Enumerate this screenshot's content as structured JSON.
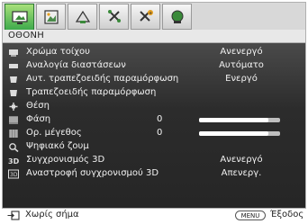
{
  "tabs": [
    {
      "icon": "display-icon",
      "active": true
    },
    {
      "icon": "picture-icon",
      "active": false
    },
    {
      "icon": "source-icon",
      "active": false
    },
    {
      "icon": "settings-icon",
      "active": false
    },
    {
      "icon": "advanced-settings-icon",
      "active": false
    },
    {
      "icon": "information-icon",
      "active": false
    }
  ],
  "section": {
    "title": "ΟΘΟΝΗ"
  },
  "menu": {
    "items": [
      {
        "icon": "wall-color-icon",
        "label": "Χρώμα τοίχου",
        "value": "Ανενεργό"
      },
      {
        "icon": "aspect-ratio-icon",
        "label": "Αναλογία διαστάσεων",
        "value": "Αυτόματο"
      },
      {
        "icon": "auto-keystone-icon",
        "label": "Αυτ. τραπεζοειδής παραμόρφωση",
        "value": "Ενεργό"
      },
      {
        "icon": "keystone-icon",
        "label": "Τραπεζοειδής παραμόρφωση",
        "value": ""
      },
      {
        "icon": "position-icon",
        "label": "Θέση",
        "value": ""
      },
      {
        "icon": "phase-icon",
        "label": "Φάση",
        "number": "0",
        "level": 0.85
      },
      {
        "icon": "h-size-icon",
        "label": "Ορ. μέγεθος",
        "number": "0",
        "level": 0.85
      },
      {
        "icon": "digital-zoom-icon",
        "label": "Ψηφιακό ζουμ",
        "value": ""
      },
      {
        "icon": "3d-icon",
        "label": "Συγχρονισμός 3D",
        "value": "Ανενεργό"
      },
      {
        "icon": "3d-sync-invert-icon",
        "label": "Αναστροφή συγχρονισμού 3D",
        "value": "Απενεργ."
      }
    ]
  },
  "footer": {
    "source_label": "Χωρίς σήμα",
    "menu_key": "MENU",
    "exit_label": "Έξοδος"
  }
}
